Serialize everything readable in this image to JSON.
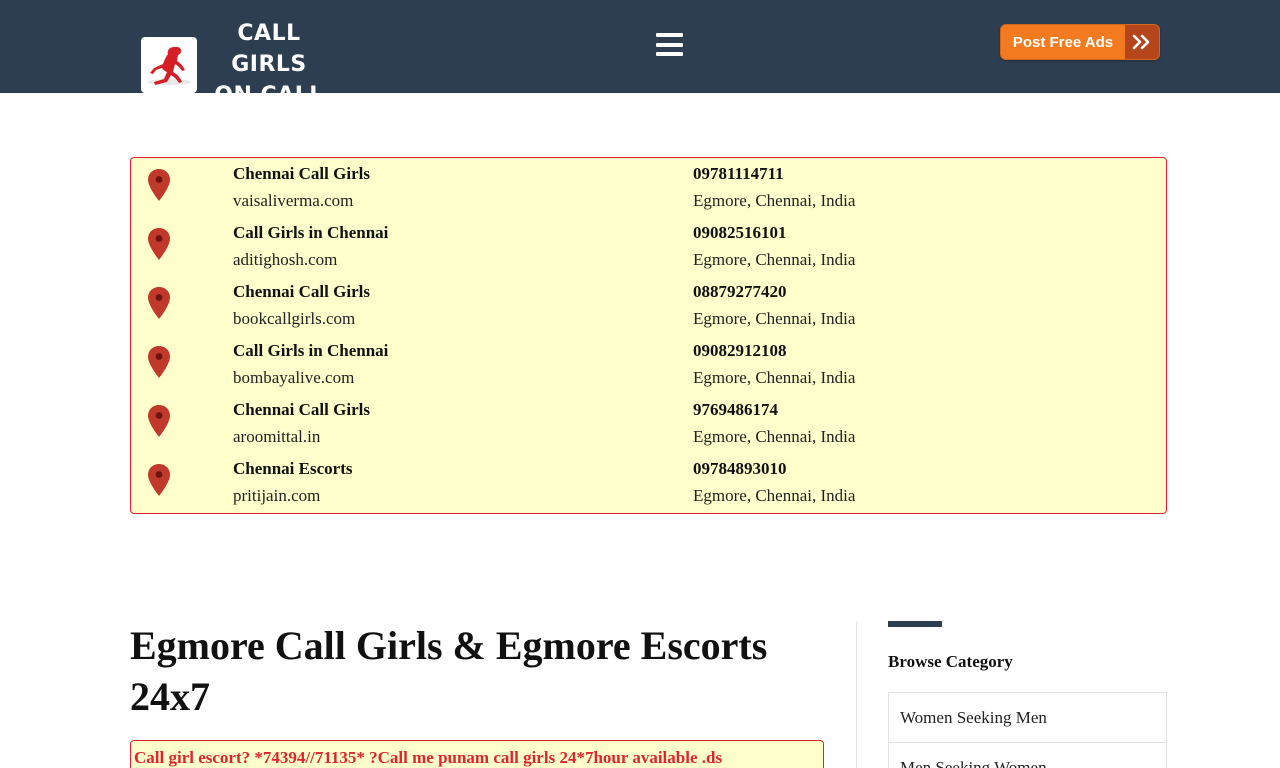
{
  "header": {
    "logo_line1": "CALL GIRLS",
    "logo_line2": "ON CALL",
    "menu_icon": "hamburger-menu-icon",
    "post_ad_label": "Post Free Ads",
    "post_ad_icon": "double-chevron-right-icon",
    "colors": {
      "bar": "#2c3e50",
      "button": "#f47a20",
      "button_dark": "#b5451b"
    }
  },
  "listings": [
    {
      "title": "Chennai Call Girls",
      "site": "vaisaliverma.com",
      "phone": "09781114711",
      "location": "Egmore, Chennai, India"
    },
    {
      "title": "Call Girls in Chennai",
      "site": "aditighosh.com",
      "phone": "09082516101",
      "location": "Egmore, Chennai, India"
    },
    {
      "title": "Chennai Call Girls",
      "site": "bookcallgirls.com",
      "phone": "08879277420",
      "location": "Egmore, Chennai, India"
    },
    {
      "title": "Call Girls in Chennai",
      "site": "bombayalive.com",
      "phone": "09082912108",
      "location": "Egmore, Chennai, India"
    },
    {
      "title": "Chennai Call Girls",
      "site": "aroomittal.in",
      "phone": "9769486174",
      "location": "Egmore, Chennai, India"
    },
    {
      "title": "Chennai Escorts",
      "site": "pritijain.com",
      "phone": "09784893010",
      "location": "Egmore, Chennai, India"
    }
  ],
  "listing_style": {
    "background": "#ffffcc",
    "border": "#e0242c",
    "pin_color": "#c0392b",
    "pin_icon": "map-pin-icon"
  },
  "main": {
    "title": "Egmore Call Girls & Egmore Escorts 24x7",
    "promo_text": "Call girl escort? *74394//71135* ?Call me punam call girls 24*7hour available .ds"
  },
  "sidebar": {
    "heading": "Browse Category",
    "categories": [
      "Women Seeking Men",
      "Men Seeking Women"
    ]
  }
}
